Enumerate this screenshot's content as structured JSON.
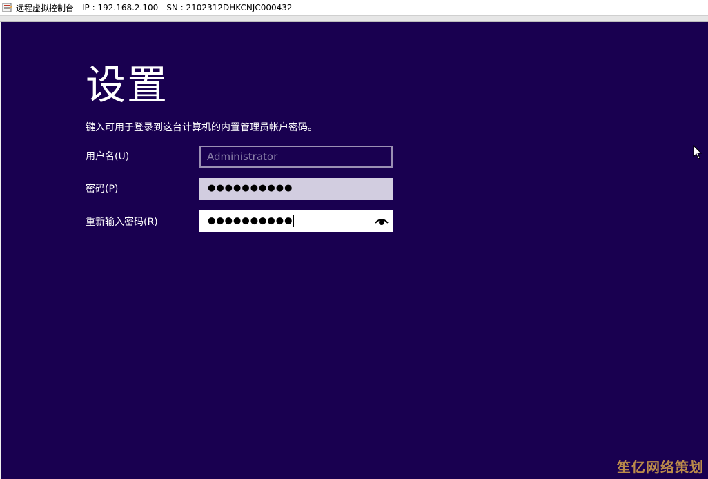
{
  "window": {
    "app_name": "远程虚拟控制台",
    "ip_text": "IP : 192.168.2.100",
    "sn_text": "SN : 2102312DHKCNJC000432"
  },
  "setup": {
    "heading": "设置",
    "instruction": "键入可用于登录到这台计算机的内置管理员帐户密码。",
    "username_label": "用户名(U)",
    "username_placeholder": "Administrator",
    "password_label": "密码(P)",
    "password_masked": "●●●●●●●●●●",
    "confirm_label": "重新输入密码(R)",
    "confirm_masked": "●●●●●●●●●●"
  },
  "watermark": "笙亿网络策划",
  "colors": {
    "background": "#190050",
    "password_field": "#d2cde0",
    "confirm_field": "#ffffff",
    "username_border": "#9a8fb3"
  },
  "icons": {
    "app": "remote-console-icon",
    "reveal": "eye-icon",
    "pointer": "mouse-cursor-icon"
  }
}
